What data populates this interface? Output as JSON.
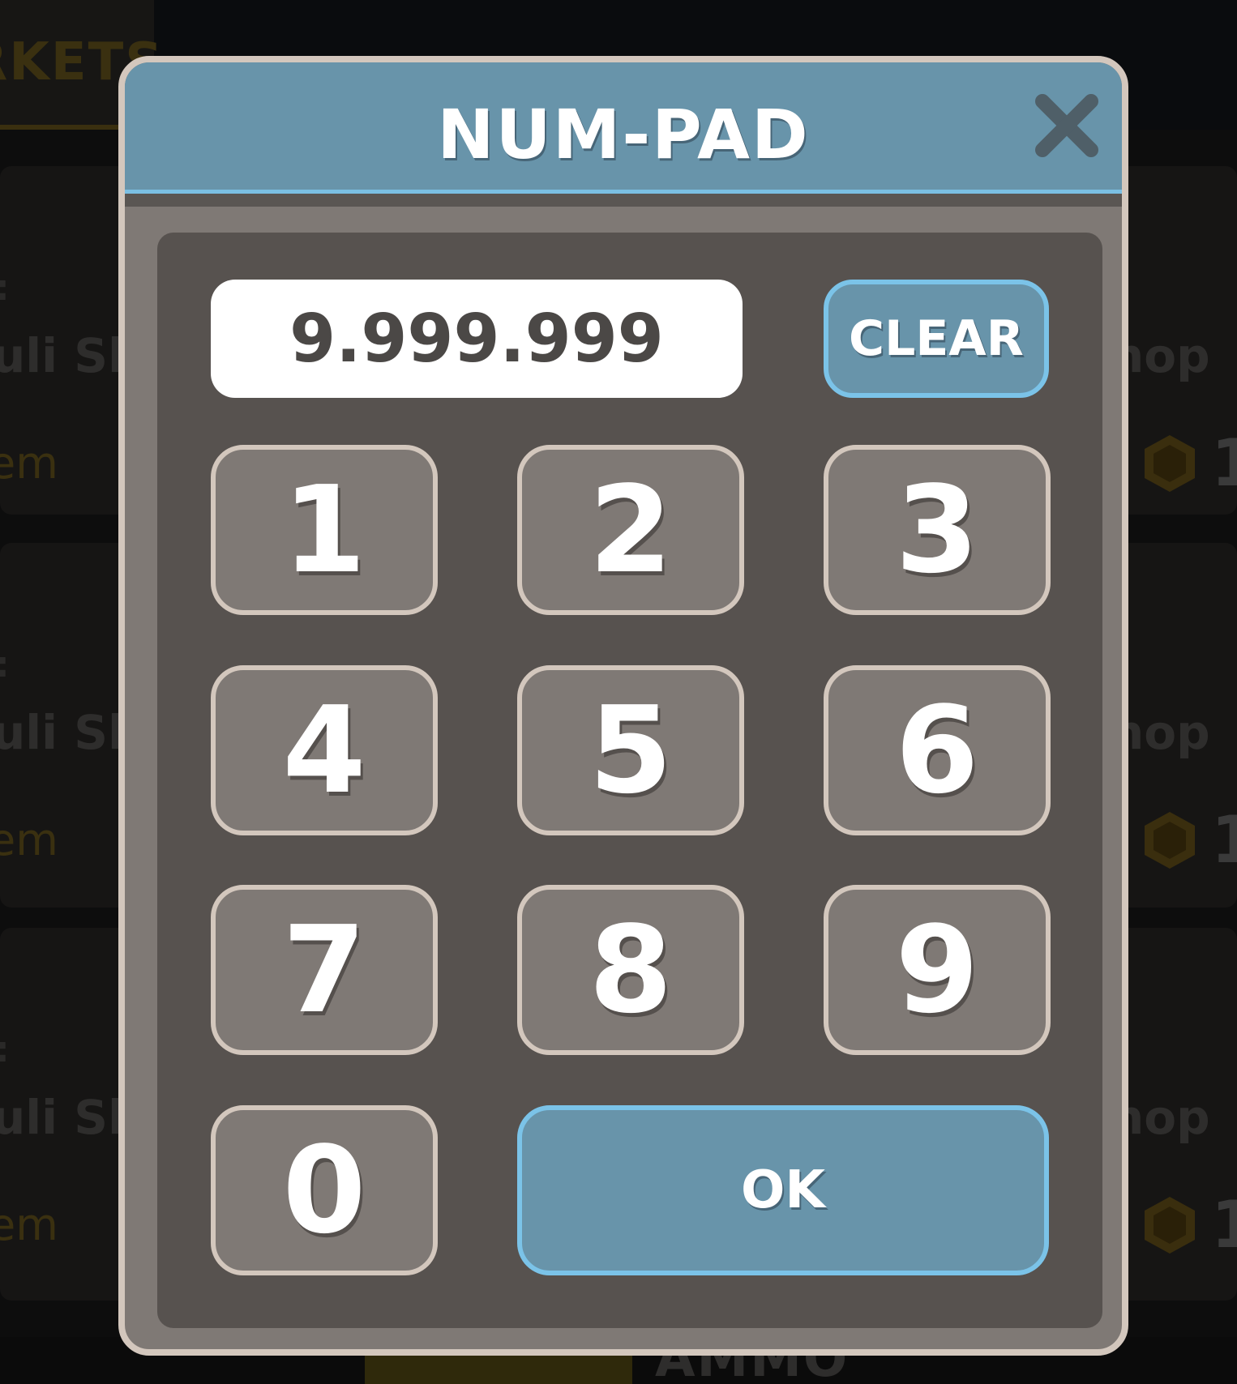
{
  "background": {
    "tab_label": "RKETS",
    "rows": [
      {
        "colon": ":",
        "left_title": "uli She",
        "right_title": "hop",
        "left_sub": "em",
        "right_value": "1"
      },
      {
        "colon": ":",
        "left_title": "uli She",
        "right_title": "hop",
        "left_sub": "em",
        "right_value": "1"
      },
      {
        "colon": ":",
        "left_title": "uli She",
        "right_title": "hop",
        "left_sub": "em",
        "right_value": "1"
      }
    ],
    "bottom_label": "AMMO"
  },
  "dialog": {
    "title": "NUM-PAD",
    "close_icon": "close-icon",
    "display_value": "9.999.999",
    "clear_label": "CLEAR",
    "keys": [
      "1",
      "2",
      "3",
      "4",
      "5",
      "6",
      "7",
      "8",
      "9",
      "0"
    ],
    "ok_label": "OK"
  },
  "colors": {
    "header_blue": "#6894aa",
    "accent_border": "#7bc3e8",
    "key_fill": "#7f7975",
    "key_border": "#d3c7bd",
    "panel_fill": "#57524f"
  }
}
